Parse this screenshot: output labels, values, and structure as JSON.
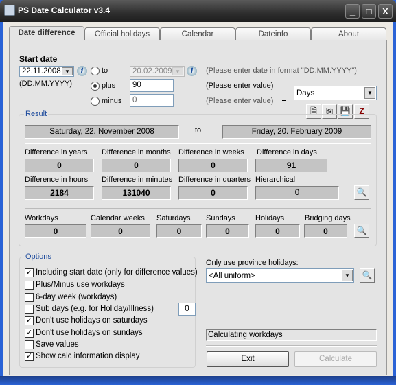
{
  "window": {
    "title": "PS Date Calculator v3.4",
    "minimize": "_",
    "maximize": "□",
    "close": "X"
  },
  "tabs": [
    {
      "label": "Date difference",
      "active": true
    },
    {
      "label": "Official holidays"
    },
    {
      "label": "Calendar"
    },
    {
      "label": "Dateinfo"
    },
    {
      "label": "About"
    }
  ],
  "start": {
    "heading": "Start date",
    "date": "22.11.2008",
    "format": "(DD.MM.YYYY)",
    "info_icon": "info-icon"
  },
  "mode": {
    "to_label": "to",
    "plus_label": "plus",
    "minus_label": "minus",
    "selected": "plus",
    "to_date": "20.02.2009",
    "plus_value": "90",
    "minus_value": "0"
  },
  "hints": {
    "date_format": "(Please enter date in format \"DD.MM.YYYY\")",
    "plus": "(Please enter value)",
    "minus": "(Please enter value)"
  },
  "unit": {
    "selected": "Days"
  },
  "result": {
    "label": "Result",
    "from": "Saturday, 22. November 2008",
    "to_label": "to",
    "to": "Friday, 20. February 2009",
    "diffs": [
      {
        "label": "Difference in years",
        "value": "0"
      },
      {
        "label": "Difference in months",
        "value": "0"
      },
      {
        "label": "Difference in weeks",
        "value": "0"
      },
      {
        "label": "Difference in days",
        "value": "91"
      },
      {
        "label": "Difference in hours",
        "value": "2184"
      },
      {
        "label": "Difference in minutes",
        "value": "131040"
      },
      {
        "label": "Difference in quarters",
        "value": "0"
      },
      {
        "label": "Hierarchical",
        "value": "0"
      }
    ],
    "counts": [
      {
        "label": "Workdays",
        "value": "0"
      },
      {
        "label": "Calendar weeks",
        "value": "0"
      },
      {
        "label": "Saturdays",
        "value": "0"
      },
      {
        "label": "Sundays",
        "value": "0"
      },
      {
        "label": "Holidays",
        "value": "0"
      },
      {
        "label": "Bridging days",
        "value": "0"
      }
    ]
  },
  "options": {
    "label": "Options",
    "items": [
      {
        "label": "Including start date (only for difference values)",
        "checked": true
      },
      {
        "label": "Plus/Minus use workdays",
        "checked": false
      },
      {
        "label": "6-day week (workdays)",
        "checked": false
      },
      {
        "label": "Sub days (e.g. for Holiday/Illness)",
        "checked": false
      },
      {
        "label": "Don't use holidays on saturdays",
        "checked": true
      },
      {
        "label": "Don't use holidays on sundays",
        "checked": true
      },
      {
        "label": "Save values",
        "checked": false
      },
      {
        "label": "Show calc information display",
        "checked": true
      }
    ],
    "sub_days_value": "0"
  },
  "province": {
    "label": "Only use province holidays:",
    "selected": "<All uniform>"
  },
  "status": "Calculating workdays",
  "buttons": {
    "exit": "Exit",
    "calculate": "Calculate"
  },
  "check_mark": "✓"
}
